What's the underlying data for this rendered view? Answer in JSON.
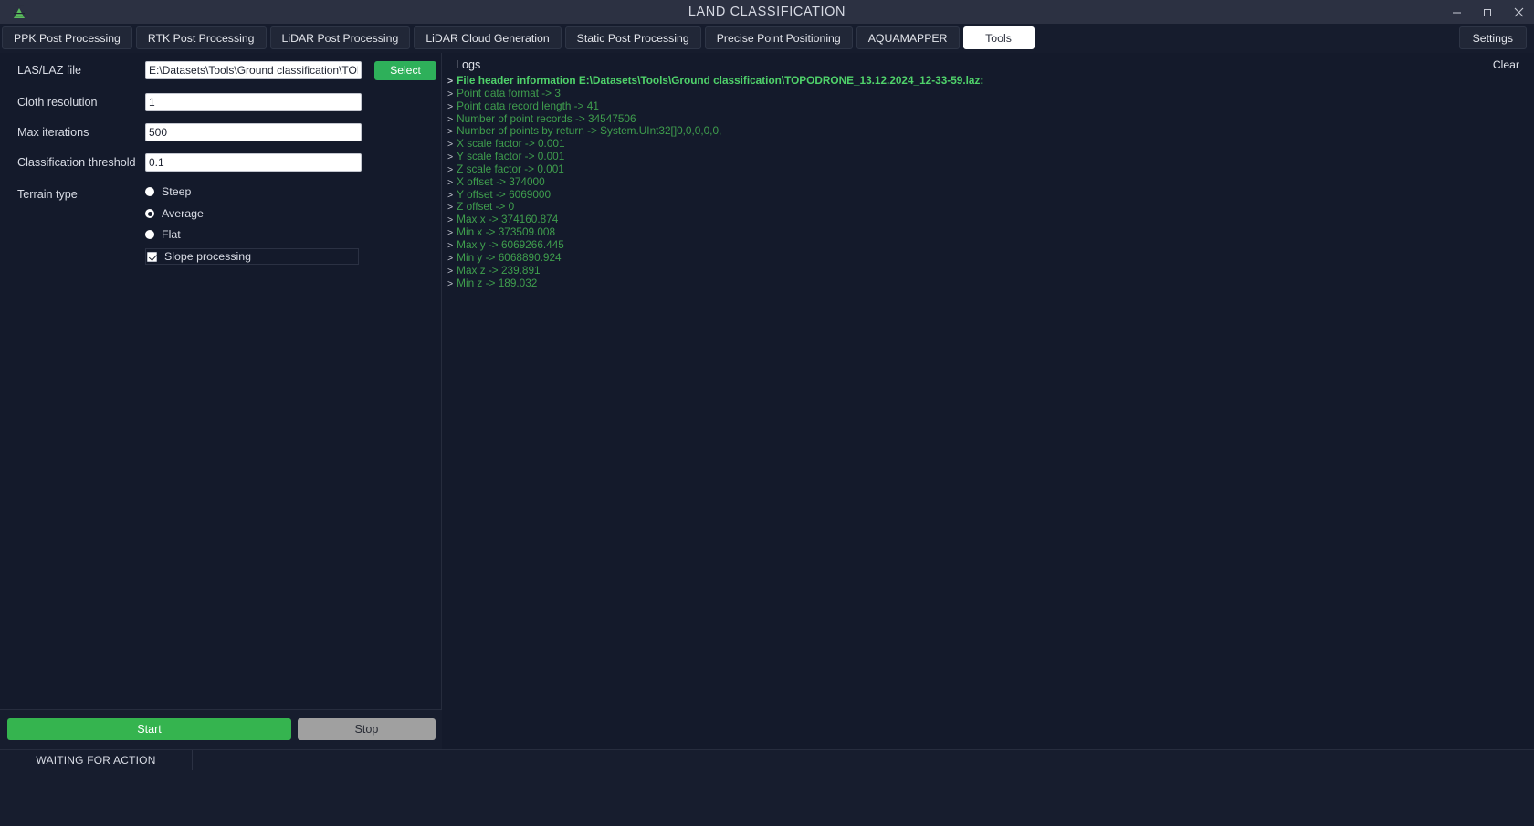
{
  "window": {
    "title": "LAND CLASSIFICATION",
    "logo_icon": "topodrone-logo-icon",
    "minimize_label": "minimize-icon",
    "restore_label": "restore-icon",
    "close_label": "close-icon"
  },
  "tabs": [
    {
      "label": "PPK Post Processing",
      "active": false
    },
    {
      "label": "RTK Post Processing",
      "active": false
    },
    {
      "label": "LiDAR Post Processing",
      "active": false
    },
    {
      "label": "LiDAR Cloud Generation",
      "active": false
    },
    {
      "label": "Static Post Processing",
      "active": false
    },
    {
      "label": "Precise Point Positioning",
      "active": false
    },
    {
      "label": "AQUAMAPPER",
      "active": false
    },
    {
      "label": "Tools",
      "active": true
    }
  ],
  "settings": {
    "label": "Settings"
  },
  "form": {
    "file_row": {
      "label": "LAS/LAZ file",
      "value": "E:\\Datasets\\Tools\\Ground classification\\TOPODR",
      "placeholder": "",
      "button_label": "Select"
    },
    "cloth_resolution": {
      "label": "Cloth resolution",
      "value": "1"
    },
    "max_iterations": {
      "label": "Max iterations",
      "value": "500"
    },
    "classification_threshold": {
      "label": "Classification threshold",
      "value": "0.1"
    },
    "terrain_type": {
      "label": "Terrain type",
      "options": [
        {
          "label": "Steep",
          "selected": false
        },
        {
          "label": "Average",
          "selected": true
        },
        {
          "label": "Flat",
          "selected": false
        }
      ]
    },
    "slope_processing": {
      "label": "Slope processing",
      "checked": true
    }
  },
  "actions": {
    "start_label": "Start",
    "stop_label": "Stop",
    "start_color": "#35b44f",
    "stop_color": "#a0a0a0"
  },
  "status": {
    "text": "WAITING FOR ACTION"
  },
  "logs": {
    "header": "Logs",
    "clear_label": "Clear",
    "lines": [
      {
        "text": "File header information E:\\Datasets\\Tools\\Ground classification\\TOPODRONE_13.12.2024_12-33-59.laz:",
        "bright": true
      },
      {
        "text": "Point data format -> 3",
        "bright": false
      },
      {
        "text": "Point data record length -> 41",
        "bright": false
      },
      {
        "text": "Number of point records -> 34547506",
        "bright": false
      },
      {
        "text": "Number of points by return -> System.UInt32[]0,0,0,0,0,",
        "bright": false
      },
      {
        "text": "X scale factor -> 0.001",
        "bright": false
      },
      {
        "text": "Y scale factor -> 0.001",
        "bright": false
      },
      {
        "text": "Z scale factor -> 0.001",
        "bright": false
      },
      {
        "text": "X offset -> 374000",
        "bright": false
      },
      {
        "text": "Y offset -> 6069000",
        "bright": false
      },
      {
        "text": "Z offset -> 0",
        "bright": false
      },
      {
        "text": "Max x -> 374160.874",
        "bright": false
      },
      {
        "text": "Min x -> 373509.008",
        "bright": false
      },
      {
        "text": "Max y -> 6069266.445",
        "bright": false
      },
      {
        "text": "Min y -> 6068890.924",
        "bright": false
      },
      {
        "text": "Max z -> 239.891",
        "bright": false
      },
      {
        "text": "Min z -> 189.032",
        "bright": false
      }
    ],
    "arrow": ">"
  }
}
